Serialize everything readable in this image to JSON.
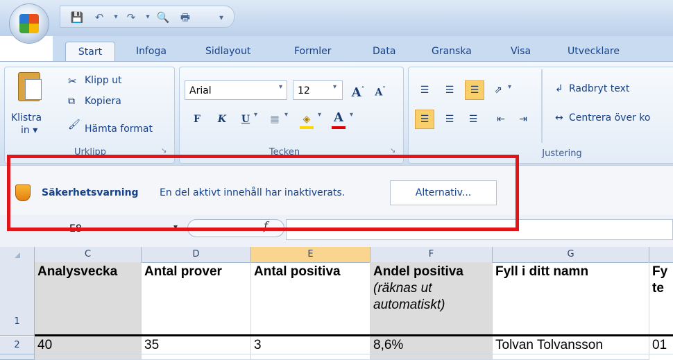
{
  "tabs": [
    "Start",
    "Infoga",
    "Sidlayout",
    "Formler",
    "Data",
    "Granska",
    "Visa",
    "Utvecklare"
  ],
  "clipboard": {
    "paste_label_line1": "Klistra",
    "paste_label_line2": "in ▾",
    "cut": "Klipp ut",
    "copy": "Kopiera",
    "format_painter": "Hämta format",
    "group_label": "Urklipp"
  },
  "font": {
    "name": "Arial",
    "size": "12",
    "bold": "F",
    "italic": "K",
    "underline": "U",
    "group_label": "Tecken"
  },
  "alignment": {
    "wrap_text": "Radbryt text",
    "merge_center": "Centrera över ko",
    "group_label": "Justering"
  },
  "security": {
    "title": "Säkerhetsvarning",
    "message": "En del aktivt innehåll har inaktiverats.",
    "options_button": "Alternativ..."
  },
  "formula_bar": {
    "name_box": "E8",
    "fx": "f"
  },
  "columns": [
    {
      "label": "",
      "name": "select-all"
    },
    {
      "label": "C"
    },
    {
      "label": "D"
    },
    {
      "label": "E",
      "selected": true
    },
    {
      "label": "F"
    },
    {
      "label": "G"
    },
    {
      "label": ""
    }
  ],
  "header_row": {
    "row_number": "1",
    "c": "Analysvecka",
    "d": "Antal prover",
    "e": "Antal positiva",
    "f_line1": "Andel positiva",
    "f_line2": "(räknas ut",
    "f_line3": "automatiskt)",
    "g": "Fyll i ditt namn",
    "h_line1": "Fy",
    "h_line2": "te"
  },
  "row2": {
    "row_number": "2",
    "c": "40",
    "d": "35",
    "e": "3",
    "f": "8,6%",
    "g": "Tolvan Tolvansson",
    "h": "01"
  },
  "colors": {
    "highlight_box": "#e0151a",
    "selected_column": "#f9d58f"
  }
}
